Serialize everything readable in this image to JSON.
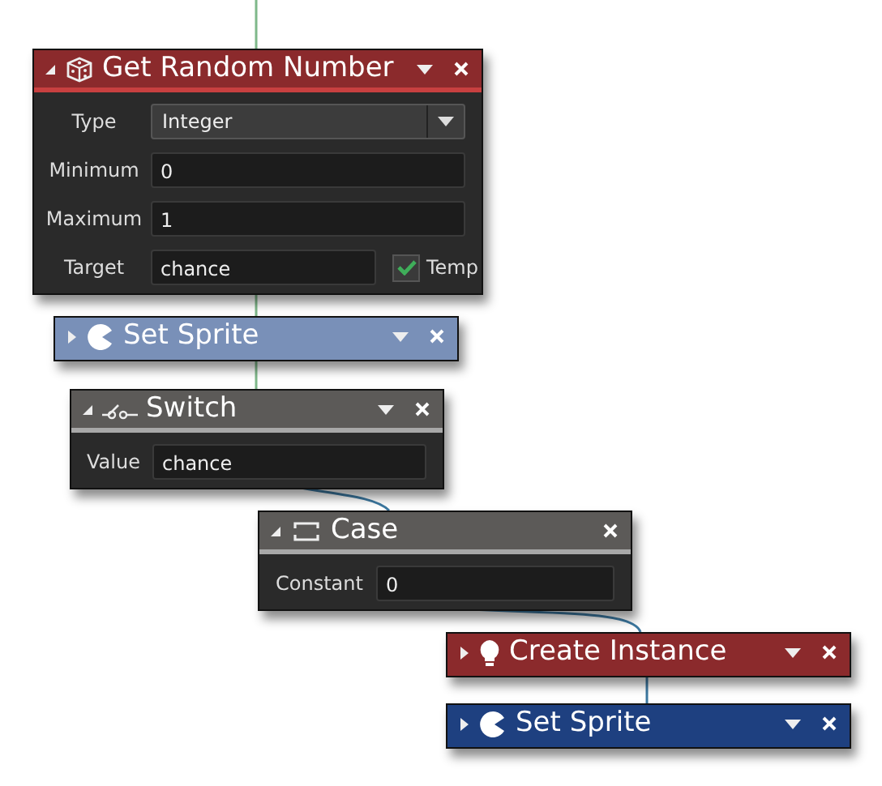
{
  "blocks": [
    {
      "kind": "random",
      "title": "Get Random Number",
      "color": "#8b2a2c",
      "expanded": true,
      "menu": true,
      "fields": [
        {
          "kind": "select",
          "label": "Type",
          "value": "Integer"
        },
        {
          "kind": "text",
          "label": "Minimum",
          "value": "0"
        },
        {
          "kind": "text",
          "label": "Maximum",
          "value": "1"
        },
        {
          "kind": "text_check",
          "label": "Target",
          "value": "chance",
          "check_label": "Temp",
          "checked": true
        }
      ]
    },
    {
      "kind": "sprite",
      "title": "Set Sprite",
      "color": "#7990b8",
      "expanded": false,
      "menu": true
    },
    {
      "kind": "switch",
      "title": "Switch",
      "color": "#5c5a58",
      "expanded": true,
      "menu": true,
      "fields": [
        {
          "kind": "text",
          "label": "Value",
          "value": "chance"
        }
      ]
    },
    {
      "kind": "case",
      "title": "Case",
      "color": "#5c5a58",
      "expanded": true,
      "menu": false,
      "fields": [
        {
          "kind": "text",
          "label": "Constant",
          "value": "0"
        }
      ]
    },
    {
      "kind": "instance",
      "title": "Create Instance",
      "color": "#8b2a2c",
      "expanded": false,
      "menu": true
    },
    {
      "kind": "sprite",
      "title": "Set Sprite",
      "color": "#1e4080",
      "expanded": false,
      "menu": true
    }
  ]
}
